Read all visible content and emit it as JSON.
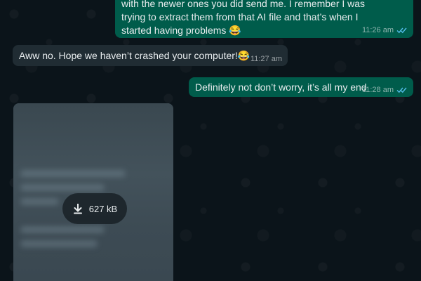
{
  "messages": [
    {
      "id": "m1",
      "direction": "outgoing",
      "text": "with the newer ones you did send me. I remember I was trying to extract them from that AI file and that’s when I started having problems 😂",
      "time": "11:26 am",
      "status_icon": "double-check-icon"
    },
    {
      "id": "m2",
      "direction": "incoming",
      "text": "Aww no. Hope we haven’t crashed your computer!😂",
      "time": "11:27 am"
    },
    {
      "id": "m3",
      "direction": "outgoing",
      "text": "Definitely not don’t worry, it’s all my end",
      "time": "11:28 am",
      "status_icon": "double-check-icon"
    }
  ],
  "media": {
    "download_size": "627 kB",
    "icon": "download-arrow-icon"
  },
  "colors": {
    "background": "#0b141a",
    "outgoing_bubble": "#005c4b",
    "incoming_bubble": "#202c33",
    "read_ticks": "#53bdeb"
  }
}
